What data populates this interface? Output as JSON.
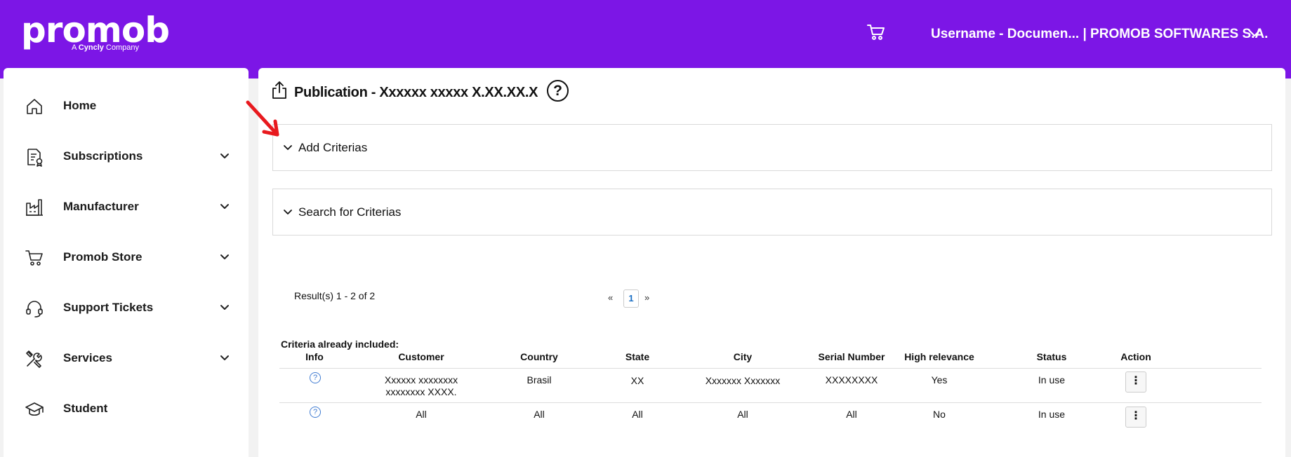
{
  "header": {
    "logo_text": "promob",
    "logo_sub_prefix": "A ",
    "logo_sub_brand": "Cyncly",
    "logo_sub_suffix": " Company",
    "user_label": "Username - Documen... | PROMOB SOFTWARES S.A.",
    "cart_icon": "cart-icon"
  },
  "sidebar": {
    "items": [
      {
        "label": "Home",
        "icon": "home-icon",
        "has_chevron": false
      },
      {
        "label": "Subscriptions",
        "icon": "certificate-icon",
        "has_chevron": true
      },
      {
        "label": "Manufacturer",
        "icon": "factory-icon",
        "has_chevron": true
      },
      {
        "label": "Promob Store",
        "icon": "cart-icon",
        "has_chevron": true
      },
      {
        "label": "Support Tickets",
        "icon": "headset-icon",
        "has_chevron": true
      },
      {
        "label": "Services",
        "icon": "tools-icon",
        "has_chevron": true
      },
      {
        "label": "Student",
        "icon": "graduation-cap-icon",
        "has_chevron": false
      }
    ]
  },
  "main": {
    "title": "Publication - Xxxxxx xxxxx  X.XX.XX.X",
    "help_symbol": "?",
    "accordions": [
      {
        "label": "Add Criterias"
      },
      {
        "label": "Search for Criterias"
      }
    ],
    "results_text": "Result(s) 1 - 2 of 2",
    "pagination": {
      "prev": "«",
      "current": "1",
      "next": "»"
    },
    "criteria_title": "Criteria already included:",
    "table": {
      "headers": [
        "Info",
        "Customer",
        "Country",
        "State",
        "City",
        "Serial Number",
        "High relevance",
        "Status",
        "Action"
      ],
      "rows": [
        {
          "customer_line1": "Xxxxxx xxxxxxxx",
          "customer_line2": "xxxxxxxx XXXX.",
          "country": "Brasil",
          "state": "XX",
          "city": "Xxxxxxx Xxxxxxx",
          "serial": "XXXXXXXX",
          "relevance": "Yes",
          "status": "In use"
        },
        {
          "customer_line1": "All",
          "customer_line2": "",
          "country": "All",
          "state": "All",
          "city": "All",
          "serial": "All",
          "relevance": "No",
          "status": "In use"
        }
      ]
    }
  },
  "colors": {
    "brand": "#7c16e6",
    "link_blue": "#3f7bd1",
    "annotation_arrow": "#e8191e"
  }
}
